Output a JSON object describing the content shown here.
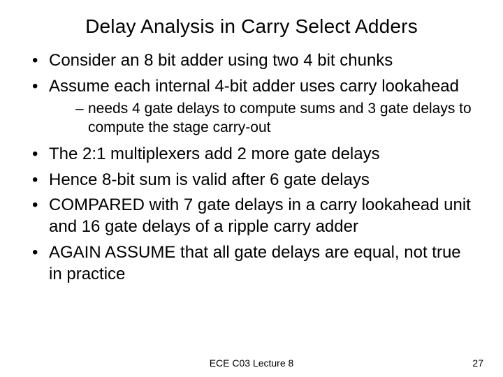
{
  "title": "Delay Analysis in Carry Select Adders",
  "bullets": {
    "b1": "Consider an 8 bit adder using two 4 bit chunks",
    "b2": "Assume each internal 4-bit adder uses carry lookahead",
    "b2_sub1": "needs 4 gate delays to compute sums and 3 gate delays to compute the stage carry-out",
    "b3": "The 2:1 multiplexers add 2 more gate delays",
    "b4": "Hence 8-bit sum is valid after 6 gate delays",
    "b5": "COMPARED with 7 gate delays in a carry lookahead unit and 16 gate delays of a ripple carry adder",
    "b6": "AGAIN ASSUME that all gate delays are equal, not true in practice"
  },
  "footer": {
    "center": "ECE C03 Lecture 8",
    "page": "27"
  }
}
